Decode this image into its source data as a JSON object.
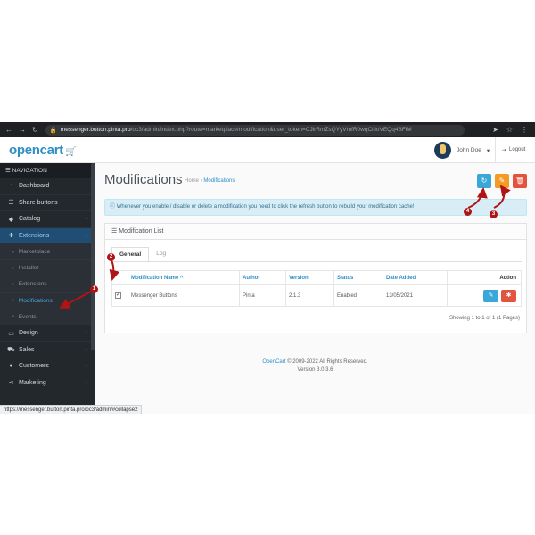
{
  "browser": {
    "url_host": "messenger.button.pinta.pro",
    "url_path": "/oc3/admin/index.php?route=marketplace/modification&user_token=CJlrRmZsQYyVmfR0wqCltioVEQq4BFlM"
  },
  "header": {
    "logo": "opencart",
    "user_name": "John Doe",
    "logout_label": "Logout"
  },
  "sidebar": {
    "nav_title": "NAVIGATION",
    "items": [
      {
        "label": "Dashboard",
        "icon": "dashboard-icon"
      },
      {
        "label": "Share buttons",
        "icon": "list-icon"
      },
      {
        "label": "Catalog",
        "icon": "tag-icon"
      },
      {
        "label": "Extensions",
        "icon": "puzzle-icon"
      },
      {
        "label": "Design",
        "icon": "monitor-icon"
      },
      {
        "label": "Sales",
        "icon": "cart-icon"
      },
      {
        "label": "Customers",
        "icon": "user-icon"
      },
      {
        "label": "Marketing",
        "icon": "share-icon"
      }
    ],
    "extensions_sub": [
      {
        "label": "Marketplace"
      },
      {
        "label": "Installer"
      },
      {
        "label": "Extensions"
      },
      {
        "label": "Modifications"
      },
      {
        "label": "Events"
      }
    ]
  },
  "main": {
    "title": "Modifications",
    "breadcrumb": {
      "home": "Home",
      "current": "Modifications"
    },
    "alert": "Whenever you enable / disable or delete a modification you need to click the refresh button to rebuild your modification cache!",
    "panel_title": "Modification List",
    "tabs": [
      {
        "label": "General"
      },
      {
        "label": "Log"
      }
    ],
    "table": {
      "headers": [
        "Modification Name ^",
        "Author",
        "Version",
        "Status",
        "Date Added",
        "Action"
      ],
      "rows": [
        {
          "name": "Messenger Buttons",
          "author": "Pinta",
          "version": "2.1.3",
          "status": "Enabled",
          "date": "13/05/2021"
        }
      ]
    },
    "showing": "Showing 1 to 1 of 1 (1 Pages)"
  },
  "footer": {
    "link": "OpenCart",
    "copyright": " © 2009-2022 All Rights Reserved.",
    "version": "Version 3.0.3.6"
  },
  "statusbar": "https://messenger.button.pinta.pro/oc3/admin/#collapse2",
  "annotations": {
    "m1": "1",
    "m2": "2",
    "m3": "3",
    "m4": "4"
  },
  "colors": {
    "brand": "#2d8fc6",
    "annotation": "#b01515",
    "refresh": "#39a8d8",
    "clear": "#f39b23",
    "delete": "#e3533f"
  }
}
